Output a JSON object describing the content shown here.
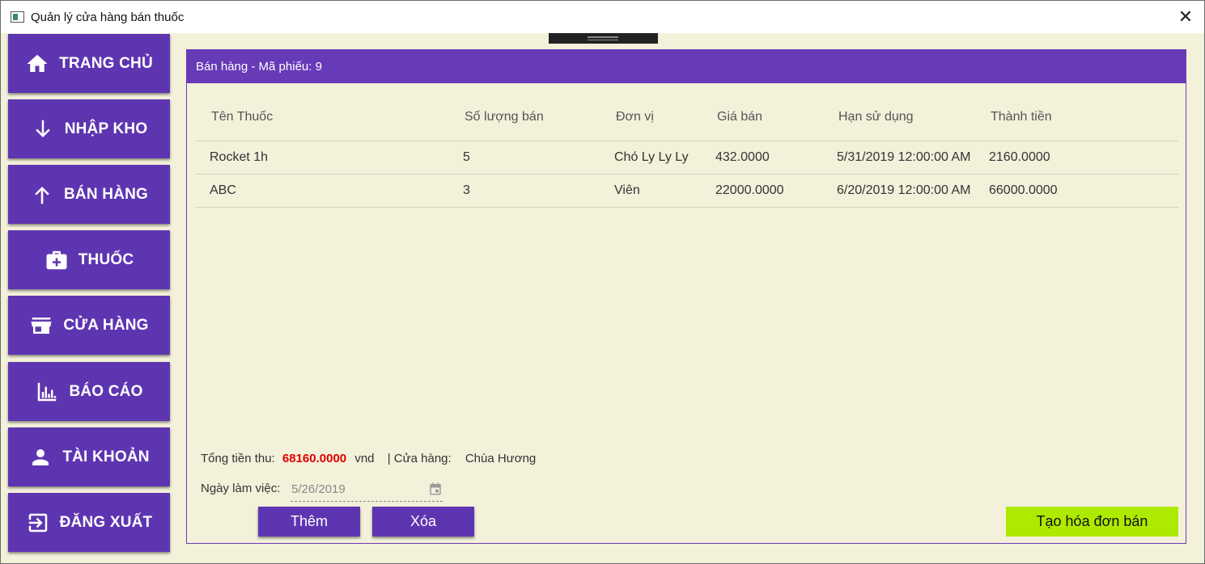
{
  "window": {
    "title": "Quản lý cửa hàng bán thuốc",
    "close_glyph": "✕"
  },
  "sidebar": {
    "items": [
      {
        "label": "TRANG CHỦ",
        "icon": "home-icon"
      },
      {
        "label": "NHẬP KHO",
        "icon": "arrow-down-icon"
      },
      {
        "label": "BÁN HÀNG",
        "icon": "arrow-up-icon"
      },
      {
        "label": "THUỐC",
        "icon": "medical-bag-icon"
      },
      {
        "label": "CỬA HÀNG",
        "icon": "store-icon"
      },
      {
        "label": "BÁO CÁO",
        "icon": "chart-icon"
      },
      {
        "label": "TÀI KHOẢN",
        "icon": "user-icon"
      },
      {
        "label": "ĐĂNG XUẤT",
        "icon": "logout-icon"
      }
    ]
  },
  "panel": {
    "header": "Bán hàng - Mã phiếu: 9"
  },
  "table": {
    "columns": [
      "Tên Thuốc",
      "Số lượng bán",
      "Đơn vị",
      "Giá bán",
      "Hạn sử dụng",
      "Thành tiền"
    ],
    "rows": [
      [
        "Rocket 1h",
        "5",
        "Chó Ly Ly Ly",
        "432.0000",
        "5/31/2019 12:00:00 AM",
        "2160.0000"
      ],
      [
        "ABC",
        "3",
        "Viên",
        "22000.0000",
        "6/20/2019 12:00:00 AM",
        "66000.0000"
      ]
    ]
  },
  "summary": {
    "total_label": "Tổng tiền thu:",
    "total_value": "68160.0000",
    "currency": "vnd",
    "store_label": "| Cửa hàng:",
    "store_value": "Chùa Hương"
  },
  "workday": {
    "label": "Ngày làm việc:",
    "value": "5/26/2019"
  },
  "buttons": {
    "add": "Thêm",
    "delete": "Xóa",
    "create_invoice": "Tạo hóa đơn bán"
  },
  "colors": {
    "accent": "#673ab7",
    "nav": "#5e35b1",
    "create": "#aeea00",
    "total": "#e00000",
    "background": "#f3f1da"
  }
}
